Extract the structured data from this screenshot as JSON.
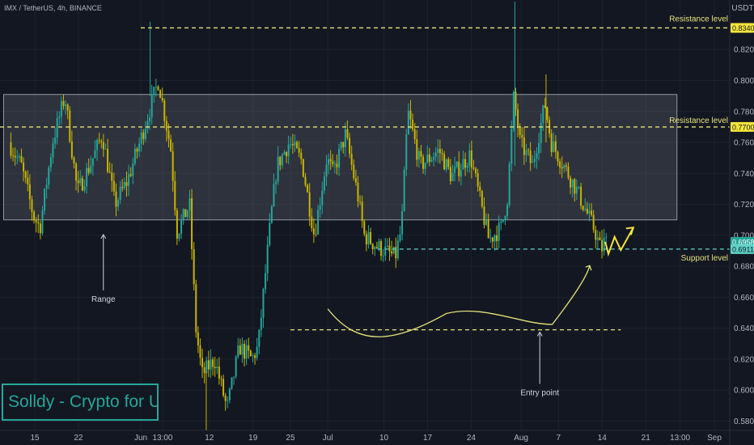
{
  "chart_data": {
    "type": "candlestick",
    "symbol_header": "IMX / TetherUS, 4h, BINANCE",
    "currency": "USDT",
    "y_ticks": [
      "0.8200",
      "0.8000",
      "0.7800",
      "0.7600",
      "0.7400",
      "0.7200",
      "0.7000",
      "0.6800",
      "0.6600",
      "0.6400",
      "0.6200",
      "0.6000",
      "0.5800"
    ],
    "ylim": [
      0.574,
      0.852
    ],
    "x_ticks": [
      "15",
      "22",
      "Jun",
      "13:00",
      "12",
      "19",
      "25",
      "Jul",
      "10",
      "17",
      "24",
      "Aug",
      "7",
      "14",
      "21",
      "13:00",
      "Sep"
    ],
    "price_tags": {
      "resistance_high": "0.8340",
      "resistance_mid": "0.7700",
      "last_price": "0.6958",
      "support": "0.6911"
    },
    "levels": {
      "resistance_high": 0.834,
      "resistance_mid": 0.77,
      "support": 0.6911,
      "entry": 0.639
    },
    "range_box": {
      "top": 0.791,
      "bottom": 0.71
    },
    "annotations": {
      "resistance_high_label": "Resistance level",
      "resistance_mid_label": "Resistance level",
      "support_label": "Support level",
      "range_label": "Range",
      "entry_label": "Entry point"
    },
    "colors": {
      "background": "#131722",
      "up": "#26a69a",
      "down": "#c8b400",
      "annotation": "#e6e27a",
      "support": "#5fd3c8",
      "box": "rgba(120,123,134,0.28)"
    },
    "anchors": [
      [
        "2023-05-11",
        0.76
      ],
      [
        "2023-05-13",
        0.745
      ],
      [
        "2023-05-15",
        0.712
      ],
      [
        "2023-05-16",
        0.705
      ],
      [
        "2023-05-18",
        0.76
      ],
      [
        "2023-05-20",
        0.79
      ],
      [
        "2023-05-22",
        0.728
      ],
      [
        "2023-05-24",
        0.745
      ],
      [
        "2023-05-26",
        0.765
      ],
      [
        "2023-05-28",
        0.72
      ],
      [
        "2023-05-30",
        0.735
      ],
      [
        "2023-06-01",
        0.76
      ],
      [
        "2023-06-04",
        0.8
      ],
      [
        "2023-06-06",
        0.755
      ],
      [
        "2023-06-07",
        0.702
      ],
      [
        "2023-06-09",
        0.72
      ],
      [
        "2023-06-10",
        0.64
      ],
      [
        "2023-06-11",
        0.61
      ],
      [
        "2023-06-13",
        0.62
      ],
      [
        "2023-06-15",
        0.588
      ],
      [
        "2023-06-17",
        0.628
      ],
      [
        "2023-06-19",
        0.62
      ],
      [
        "2023-06-20",
        0.628
      ],
      [
        "2023-06-22",
        0.71
      ],
      [
        "2023-06-23",
        0.745
      ],
      [
        "2023-06-25",
        0.76
      ],
      [
        "2023-06-27",
        0.748
      ],
      [
        "2023-06-29",
        0.7
      ],
      [
        "2023-07-01",
        0.75
      ],
      [
        "2023-07-02",
        0.74
      ],
      [
        "2023-07-04",
        0.765
      ],
      [
        "2023-07-06",
        0.725
      ],
      [
        "2023-07-07",
        0.7
      ],
      [
        "2023-07-09",
        0.693
      ],
      [
        "2023-07-12",
        0.686
      ],
      [
        "2023-07-13",
        0.705
      ],
      [
        "2023-07-14",
        0.78
      ],
      [
        "2023-07-16",
        0.745
      ],
      [
        "2023-07-19",
        0.755
      ],
      [
        "2023-07-21",
        0.738
      ],
      [
        "2023-07-24",
        0.752
      ],
      [
        "2023-07-26",
        0.715
      ],
      [
        "2023-07-27",
        0.697
      ],
      [
        "2023-07-29",
        0.705
      ],
      [
        "2023-07-30",
        0.725
      ],
      [
        "2023-07-31",
        0.79
      ],
      [
        "2023-08-01",
        0.76
      ],
      [
        "2023-08-03",
        0.745
      ],
      [
        "2023-08-05",
        0.785
      ],
      [
        "2023-08-06",
        0.76
      ],
      [
        "2023-08-08",
        0.745
      ],
      [
        "2023-08-10",
        0.73
      ],
      [
        "2023-08-12",
        0.712
      ],
      [
        "2023-08-13",
        0.703
      ],
      [
        "2023-08-14",
        0.69
      ],
      [
        "2023-08-14T12:00",
        0.6958
      ]
    ],
    "projection": [
      [
        "2023-08-14T12:00",
        0.6958
      ],
      [
        "2023-08-15",
        0.688
      ],
      [
        "2023-08-16",
        0.699
      ],
      [
        "2023-08-17",
        0.6905
      ],
      [
        "2023-08-19",
        0.705
      ]
    ],
    "entry_curve": [
      [
        "2023-07-01",
        0.6525
      ],
      [
        "2023-07-06",
        0.6265
      ],
      [
        "2023-07-12",
        0.6315
      ],
      [
        "2023-07-20",
        0.6495
      ],
      [
        "2023-07-26",
        0.6555
      ],
      [
        "2023-08-01",
        0.6425
      ],
      [
        "2023-08-06",
        0.6425
      ],
      [
        "2023-08-12",
        0.6805
      ]
    ],
    "entry_line_range": [
      "2023-06-25",
      "2023-08-17"
    ],
    "support_line_range": [
      "2023-07-09",
      "2023-08-20"
    ]
  }
}
